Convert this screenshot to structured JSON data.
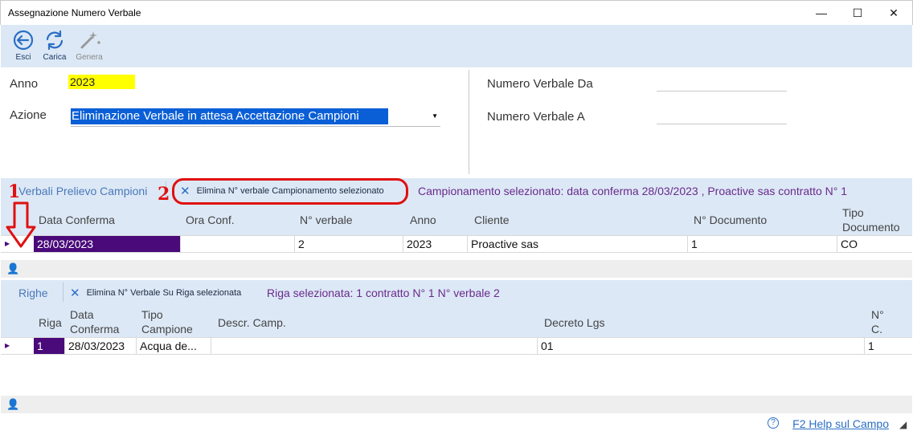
{
  "window": {
    "title": "Assegnazione Numero Verbale",
    "minimize": "—",
    "maximize": "☐",
    "close": "✕"
  },
  "toolbar": {
    "esci_label": "Esci",
    "carica_label": "Carica",
    "genera_label": "Genera"
  },
  "form": {
    "anno_label": "Anno",
    "anno_value": "2023",
    "azione_label": "Azione",
    "azione_value": "Eliminazione Verbale in attesa Accettazione Campioni",
    "numero_da_label": "Numero Verbale Da",
    "numero_a_label": "Numero Verbale A"
  },
  "verbali": {
    "section_title": "Verbali Prelievo Campioni",
    "elimina_button": "Elimina N° verbale Campionamento selezionato",
    "selection_info": "Campionamento selezionato: data conferma 28/03/2023 , Proactive sas contratto N° 1",
    "columns": {
      "data_conferma": "Data Conferma",
      "ora_conf": "Ora Conf.",
      "n_verbale": "N° verbale",
      "anno": "Anno",
      "cliente": "Cliente",
      "n_documento": "N° Documento",
      "tipo_documento_1": "Tipo",
      "tipo_documento_2": "Documento"
    },
    "row": {
      "data_conferma": "28/03/2023",
      "ora_conf": "",
      "n_verbale": "2",
      "anno": "2023",
      "cliente": "Proactive sas",
      "n_documento": "1",
      "tipo_documento": "CO"
    }
  },
  "righe": {
    "section_title": "Righe",
    "elimina_button": "Elimina N° Verbale Su Riga  selezionata",
    "selection_info": "Riga selezionata: 1 contratto N° 1 N° verbale 2",
    "columns": {
      "riga": "Riga",
      "data_conferma_1": "Data",
      "data_conferma_2": "Conferma",
      "tipo_campione_1": "Tipo",
      "tipo_campione_2": "Campione",
      "descr_camp": "Descr. Camp.",
      "decreto_lgs": "Decreto Lgs",
      "n_c_1": "N°",
      "n_c_2": "C."
    },
    "row": {
      "riga": "1",
      "data_conferma": "28/03/2023",
      "tipo_campione": "Acqua de...",
      "descr_camp": "",
      "decreto_lgs": "01",
      "n_c": "1"
    }
  },
  "annotations": {
    "marker_1": "1",
    "marker_2": "2"
  },
  "status": {
    "help_icon": "?",
    "help_text": "F2 Help sul Campo"
  },
  "colors": {
    "strip": "#dce8f6",
    "selected_cell": "#4a0a7a",
    "azione_highlight": "#0a5fd6",
    "anno_highlight": "#ffff00",
    "annotation_red": "#e01010"
  },
  "icons": {
    "esci": "back-arrow-icon",
    "carica": "refresh-icon",
    "genera": "wand-icon",
    "elimina": "close-x-icon",
    "person": "person-icon",
    "help": "help-circle-icon"
  }
}
